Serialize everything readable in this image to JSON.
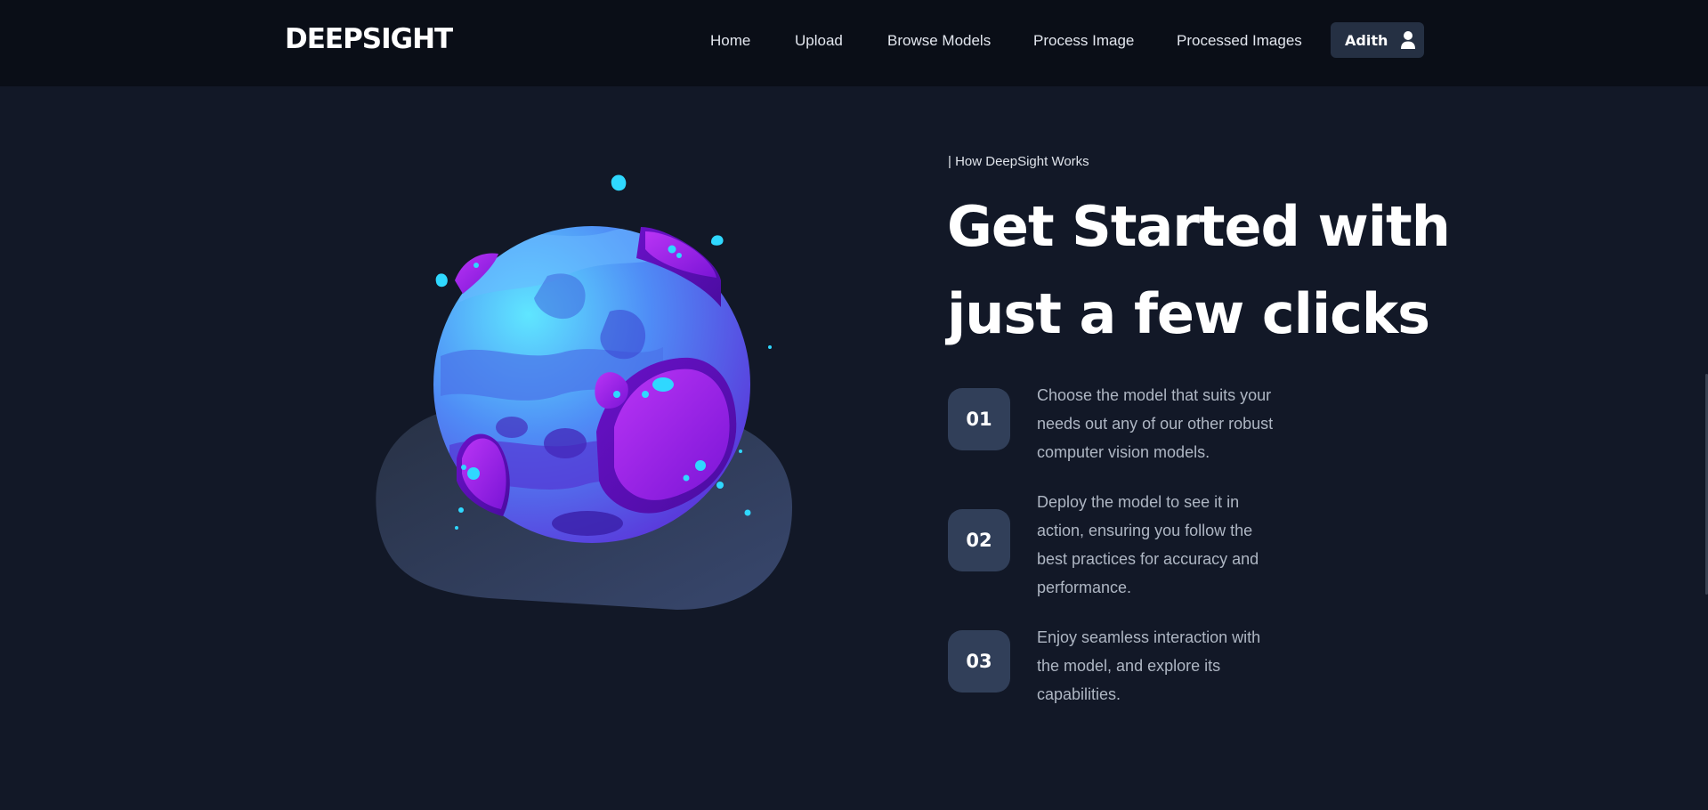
{
  "brand": "DEEPSIGHT",
  "nav": {
    "links": [
      "Home",
      "Upload",
      "Browse Models",
      "Process Image",
      "Processed Images"
    ],
    "user_name": "Adith"
  },
  "hero": {
    "eyebrow": "| How DeepSight Works",
    "headline_line1": "Get Started with",
    "headline_line2": "just a few clicks",
    "steps": [
      {
        "number": "01",
        "text": "Choose the model that suits your needs out any of our other robust computer vision models."
      },
      {
        "number": "02",
        "text": "Deploy the model to see it in action, ensuring you follow the best practices for accuracy and performance."
      },
      {
        "number": "03",
        "text": "Enjoy seamless interaction with the model, and explore its capabilities."
      }
    ]
  },
  "colors": {
    "page_bg": "#121827",
    "nav_bg": "#0a0e17",
    "step_badge_bg": "#313f59",
    "user_button_bg": "#253043",
    "planet_blue": "#5fa8ff",
    "planet_purple": "#9b2bea",
    "accent_cyan": "#2ee4ff"
  },
  "icons": {
    "user": "user-icon",
    "illustration": "planet-illustration"
  }
}
